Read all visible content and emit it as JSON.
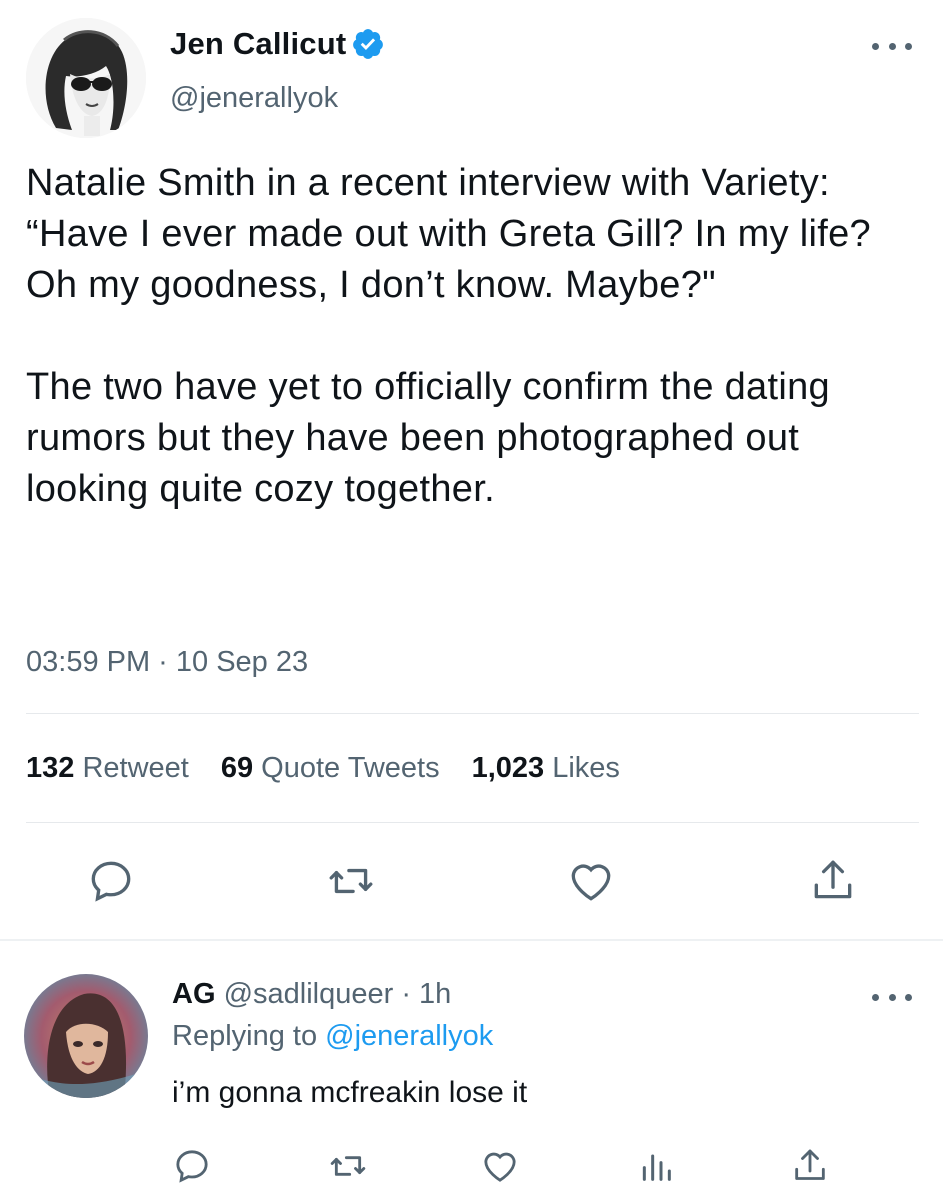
{
  "tweet": {
    "author": {
      "name": "Jen Callicut",
      "handle": "@jenerallyok",
      "verified": true
    },
    "text": "Natalie Smith in a recent interview with Variety: “Have I ever made out with Greta Gill? In my life? Oh my goodness, I don’t know. Maybe?\"\n\nThe two have yet to officially confirm the dating rumors but they have been photographed out looking quite cozy together.",
    "timestamp": "03:59 PM · 10 Sep 23",
    "stats": [
      {
        "count": "132",
        "label": "Retweet"
      },
      {
        "count": "69",
        "label": "Quote Tweets"
      },
      {
        "count": "1,023",
        "label": "Likes"
      }
    ],
    "actions": [
      "reply-icon",
      "retweet-icon",
      "like-icon",
      "share-icon"
    ]
  },
  "reply": {
    "name": "AG",
    "handle": "@sadlilqueer",
    "time": "· 1h",
    "replying_prefix": "Replying to",
    "replying_to": "@jenerallyok",
    "text": "i’m gonna mcfreakin lose it",
    "actions": [
      "reply-icon",
      "retweet-icon",
      "like-icon",
      "analytics-icon",
      "share-icon"
    ]
  },
  "colors": {
    "text": "#0f1419",
    "secondary": "#536471",
    "accent": "#1d9bf0",
    "divider": "#e6e9ec"
  }
}
